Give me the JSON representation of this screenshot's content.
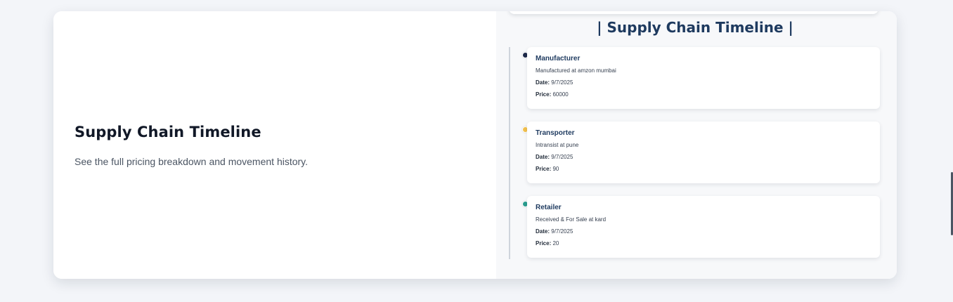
{
  "left": {
    "title": "Supply Chain Timeline",
    "description": "See the full pricing breakdown and movement history."
  },
  "right": {
    "title": "| Supply Chain Timeline |"
  },
  "labels": {
    "date": "Date:",
    "price": "Price:"
  },
  "timeline": [
    {
      "role": "Manufacturer",
      "description": "Manufactured at amzon mumbai",
      "date": "9/7/2025",
      "price": "60000",
      "dot_color": "#1e2a4a"
    },
    {
      "role": "Transporter",
      "description": "Intransist at pune",
      "date": "9/7/2025",
      "price": "90",
      "dot_color": "#f2c14e"
    },
    {
      "role": "Retailer",
      "description": "Received & For Sale at kard",
      "date": "9/7/2025",
      "price": "20",
      "dot_color": "#2a9d8f"
    }
  ]
}
